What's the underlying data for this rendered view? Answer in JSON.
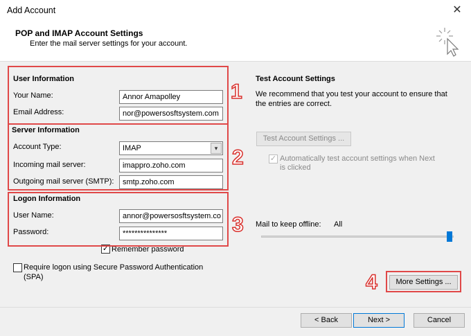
{
  "window": {
    "title": "Add Account",
    "close_glyph": "✕"
  },
  "header": {
    "title": "POP and IMAP Account Settings",
    "subtitle": "Enter the mail server settings for your account."
  },
  "user_info": {
    "heading": "User Information",
    "name_label": "Your Name:",
    "name_value": "Annor Amapolley",
    "email_label": "Email Address:",
    "email_value": "nor@powersosftsystem.com"
  },
  "server_info": {
    "heading": "Server Information",
    "account_type_label": "Account Type:",
    "account_type_value": "IMAP",
    "incoming_label": "Incoming mail server:",
    "incoming_value": "imappro.zoho.com",
    "outgoing_label": "Outgoing mail server (SMTP):",
    "outgoing_value": "smtp.zoho.com"
  },
  "logon_info": {
    "heading": "Logon Information",
    "username_label": "User Name:",
    "username_value": "annor@powersosftsystem.co",
    "password_label": "Password:",
    "password_value": "***************",
    "remember_label": "Remember password",
    "remember_checked": true
  },
  "spa": {
    "label_line1": "Require logon using Secure Password Authentication",
    "label_line2": "(SPA)",
    "checked": false
  },
  "test": {
    "heading": "Test Account Settings",
    "desc_line1": "We recommend that you test your account to ensure that",
    "desc_line2": "the entries are correct.",
    "button": "Test Account Settings ...",
    "auto_line1": "Automatically test account settings when Next",
    "auto_line2": "is clicked",
    "auto_checked": true
  },
  "offline": {
    "label": "Mail to keep offline:",
    "value": "All",
    "level": 1.0
  },
  "more_settings": "More Settings ...",
  "footer": {
    "back": "< Back",
    "next": "Next >",
    "cancel": "Cancel"
  },
  "annotations": [
    "1",
    "2",
    "3",
    "4"
  ],
  "colors": {
    "annotation_red": "#e04848",
    "accent": "#0078d7",
    "panel": "#f0f0f0"
  },
  "icons": [
    "wizard-wand-icon",
    "close-icon",
    "dropdown-arrow-icon",
    "checkmark-icon"
  ]
}
